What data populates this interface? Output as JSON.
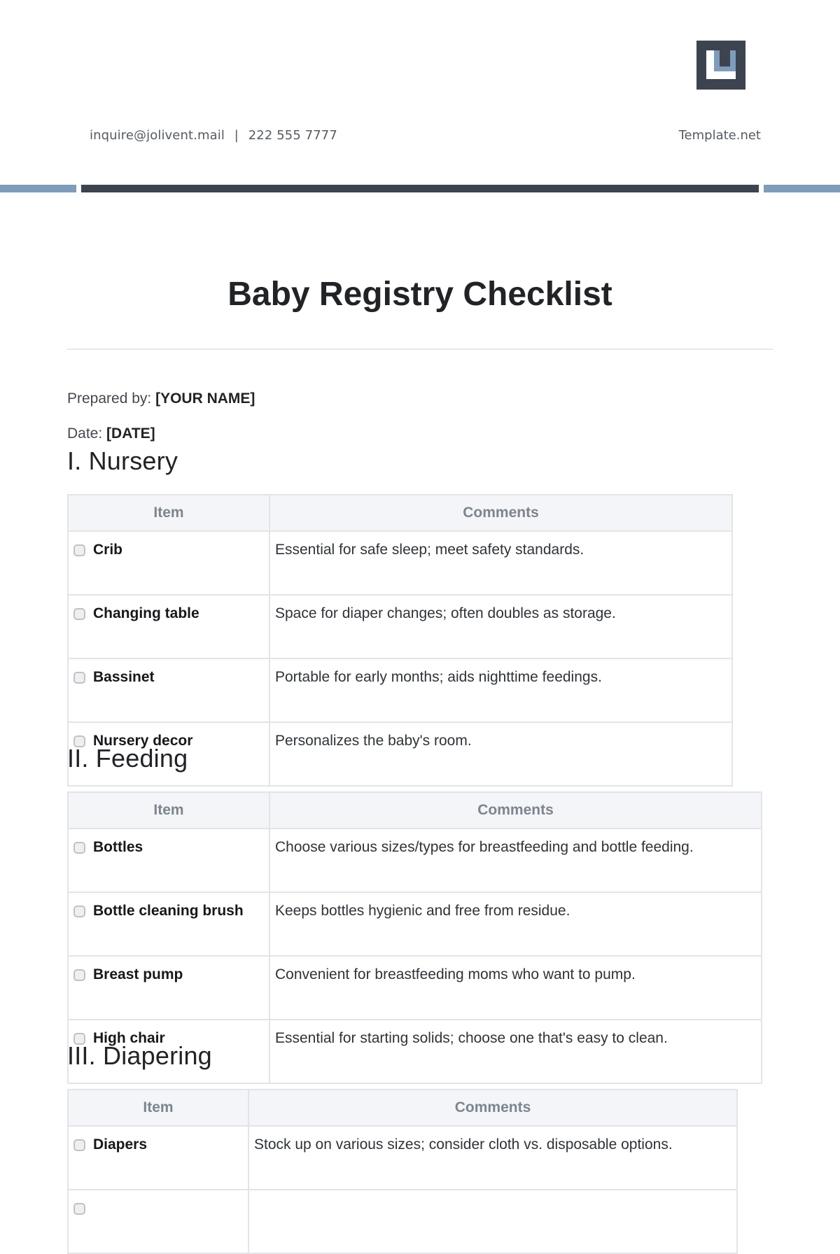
{
  "header": {
    "logo_icon": "template-net-logo-icon",
    "contact_email": "inquire@jolivent.mail",
    "contact_separator": "|",
    "contact_phone": "222 555 7777",
    "brand": "Template.net",
    "colors": {
      "dark": "#3d4450",
      "accent": "#7e9cbb"
    }
  },
  "document": {
    "title": "Baby Registry Checklist",
    "prepared_by_label": "Prepared by:",
    "prepared_by_value": "[YOUR NAME]",
    "date_label": "Date:",
    "date_value": "[DATE]"
  },
  "sections": [
    {
      "heading": "I. Nursery",
      "columns": [
        "Item",
        "Comments"
      ],
      "rows": [
        {
          "item": "Crib",
          "checked": false,
          "comment": "Essential for safe sleep; meet safety standards."
        },
        {
          "item": "Changing table",
          "checked": false,
          "comment": "Space for diaper changes; often doubles as storage."
        },
        {
          "item": "Bassinet",
          "checked": false,
          "comment": "Portable for early months; aids nighttime feedings."
        },
        {
          "item": "Nursery decor",
          "checked": false,
          "comment": "Personalizes the baby's room."
        }
      ]
    },
    {
      "heading": "II. Feeding",
      "columns": [
        "Item",
        "Comments"
      ],
      "rows": [
        {
          "item": "Bottles",
          "checked": false,
          "comment": "Choose various sizes/types for breastfeeding and bottle feeding."
        },
        {
          "item": "Bottle cleaning brush",
          "checked": false,
          "comment": "Keeps bottles hygienic and free from residue."
        },
        {
          "item": "Breast pump",
          "checked": false,
          "comment": "Convenient for breastfeeding moms who want to pump."
        },
        {
          "item": "High chair",
          "checked": false,
          "comment": "Essential for starting solids; choose one that's easy to clean."
        }
      ]
    },
    {
      "heading": "III. Diapering",
      "columns": [
        "Item",
        "Comments"
      ],
      "rows": [
        {
          "item": "Diapers",
          "checked": false,
          "comment": "Stock up on various sizes; consider cloth vs. disposable options."
        },
        {
          "item": "",
          "checked": false,
          "comment": ""
        }
      ]
    }
  ]
}
